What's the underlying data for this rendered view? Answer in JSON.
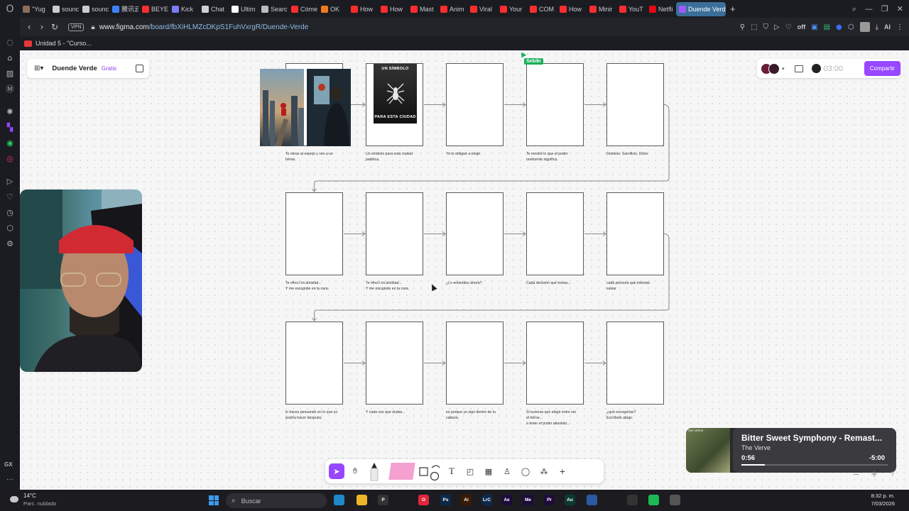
{
  "browser": {
    "tabs": [
      {
        "label": "\"Yug",
        "color": "#8a6d5a"
      },
      {
        "label": "sounc",
        "color": "#cccccc"
      },
      {
        "label": "sounc",
        "color": "#cccccc"
      },
      {
        "label": "騰讯云",
        "color": "#3b82f6"
      },
      {
        "label": "BEYE",
        "color": "#ff2d2d"
      },
      {
        "label": "Kick",
        "color": "#7b7bf5"
      },
      {
        "label": "Chat",
        "color": "#d0d0d0"
      },
      {
        "label": "Ultim",
        "color": "#ffffff"
      },
      {
        "label": "Searc",
        "color": "#bbbbbb"
      },
      {
        "label": "Cóme",
        "color": "#ff2d2d"
      },
      {
        "label": "OK",
        "color": "#f07b1a"
      },
      {
        "label": "How",
        "color": "#ff2d2d"
      },
      {
        "label": "How",
        "color": "#ff2d2d"
      },
      {
        "label": "Mast",
        "color": "#ff2d2d"
      },
      {
        "label": "Anim",
        "color": "#ff2d2d"
      },
      {
        "label": "Viral",
        "color": "#ff2d2d"
      },
      {
        "label": "Your",
        "color": "#ff2d2d"
      },
      {
        "label": "COM",
        "color": "#ff2d2d"
      },
      {
        "label": "How",
        "color": "#ff2d2d"
      },
      {
        "label": "Minir",
        "color": "#ff2d2d"
      },
      {
        "label": "YouT",
        "color": "#ff2d2d"
      },
      {
        "label": "Netfli",
        "color": "#e50914"
      },
      {
        "label": "Duende Verde",
        "color": "#a259ff"
      }
    ],
    "new_tab": "+",
    "url_host": "www.figma.com",
    "url_path": "/board/fbXiHLMZcDKpS1FuhVxrgR/Duende-Verde",
    "vpn_label": "VPN",
    "off_label": "off",
    "ai_label": "AI",
    "bookmark_label": "Unidad 5 - \"Curso..."
  },
  "figma": {
    "file_name": "Duende Verde",
    "plan_badge": "Gratis",
    "timer": "03:00",
    "share_label": "Compartir",
    "user_tag": "Sebiki",
    "accent_color": "#9747ff",
    "poster_top": "UN SÍMBOLO",
    "poster_bottom": "PARA ESTA CIUDAD",
    "captions": [
      "Te miras al espejo y ves a un\nhéroe.",
      "Un símbolo para esta ciudad\npatética.",
      "Yo te obligué a elegir.",
      "Te mostré lo que el poder\nrealmente significa.",
      "Dominio.  Sacrificio. Dolor.",
      "Te ofrecí mi amistad...\nY me escupiste en la cara.",
      "Te ofrecí mi amistad...\nY me escupiste en la cara.",
      "¿Lo entiendes ahora?",
      "Cada decisión que tomas...",
      "cada persona que intentas\nsalvar",
      "lo haces pensando en lo que yo\npodría hacer después.",
      "Y cada vez que dudas...",
      "es porque yo sigo dentro de tu\ncabeza.",
      "Si tuvieras que elegir entre ser\nel héroe...\no tener el poder absoluto...",
      "¿qué escogerías?\nEscríbelo abajo."
    ]
  },
  "player": {
    "album_label": "THE VERVE",
    "track_title": "Bitter Sweet Symphony - Remast...",
    "artist": "The Verve",
    "elapsed": "0:56",
    "remaining": "-5:00",
    "progress": 0.16
  },
  "taskbar": {
    "weather_temp": "14°C",
    "weather_desc": "Parc. nublado",
    "search_placeholder": "Buscar",
    "time": "8:32 p. m.",
    "date": "7/03/2026",
    "apps": [
      {
        "name": "edge",
        "label": "",
        "color": "#1e88c9"
      },
      {
        "name": "file-explorer",
        "label": "",
        "color": "#f0b429"
      },
      {
        "name": "p-app",
        "label": "P",
        "color": "#333333"
      },
      {
        "name": "opera",
        "label": "O",
        "color": "#e0263a"
      },
      {
        "name": "photoshop",
        "label": "Ps",
        "color": "#0b2a4a"
      },
      {
        "name": "illustrator",
        "label": "Ai",
        "color": "#3a1a05"
      },
      {
        "name": "lightroom",
        "label": "LrC",
        "color": "#0b2a4a"
      },
      {
        "name": "after-effects",
        "label": "Ae",
        "color": "#1f0b3a"
      },
      {
        "name": "media-encoder",
        "label": "Me",
        "color": "#1f0b3a"
      },
      {
        "name": "premiere",
        "label": "Pr",
        "color": "#1f0b3a"
      },
      {
        "name": "audition",
        "label": "Au",
        "color": "#0b3a33"
      },
      {
        "name": "opera-gx",
        "label": "",
        "color": "#2c5aa0"
      },
      {
        "name": "obs",
        "label": "",
        "color": "#333333"
      },
      {
        "name": "spotify",
        "label": "",
        "color": "#1db954"
      },
      {
        "name": "app-window",
        "label": "",
        "color": "#555555"
      }
    ]
  }
}
